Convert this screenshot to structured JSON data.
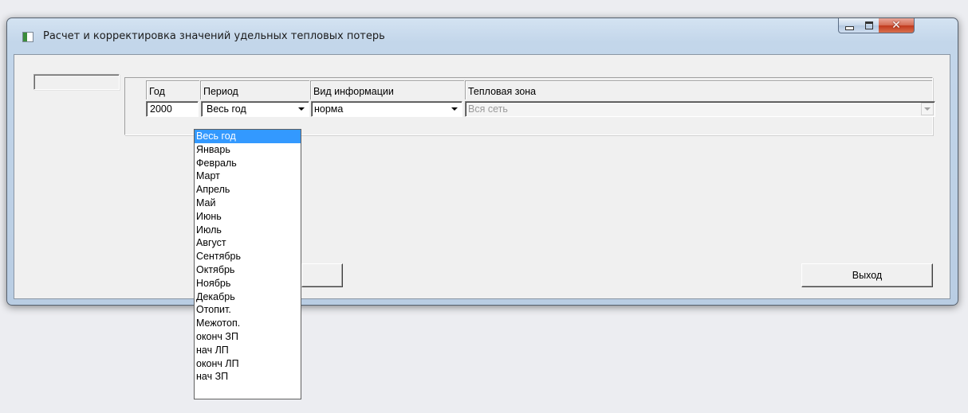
{
  "window": {
    "title": "Расчет и корректировка значений удельных тепловых потерь",
    "controls": {
      "minimize": "minimize-icon",
      "maximize": "maximize-icon",
      "close": "close-icon"
    }
  },
  "form": {
    "headers": {
      "year": "Год",
      "period": "Период",
      "info_type": "Вид информации",
      "thermal_zone": "Тепловая зона"
    },
    "fields": {
      "year": "2000",
      "period": "Весь год",
      "info_type": "норма",
      "thermal_zone": "Вся сеть"
    }
  },
  "period_options": [
    "Весь год",
    "Январь",
    "Февраль",
    "Март",
    "Апрель",
    "Май",
    "Июнь",
    "Июль",
    "Август",
    "Сентябрь",
    "Октябрь",
    "Ноябрь",
    "Декабрь",
    "Отопит.",
    "Межотоп.",
    "оконч ЗП",
    "нач ЛП",
    "оконч ЛП",
    "нач ЗП"
  ],
  "buttons": {
    "exit": "Выход"
  },
  "colors": {
    "selection": "#3399ff",
    "close_button": "#c1391d"
  }
}
